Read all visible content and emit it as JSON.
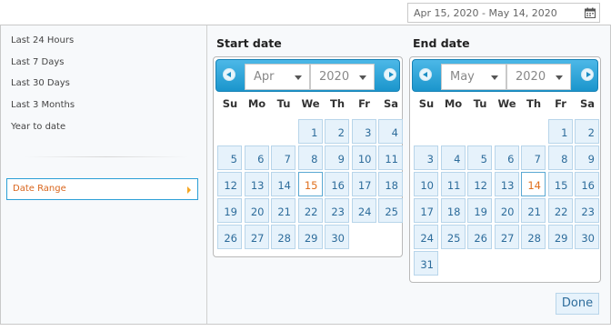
{
  "range_input": {
    "value": "Apr 15, 2020 - May 14, 2020",
    "icon": "calendar-icon"
  },
  "presets": [
    {
      "label": "Last 24 Hours"
    },
    {
      "label": "Last 7 Days"
    },
    {
      "label": "Last 30 Days"
    },
    {
      "label": "Last 3 Months"
    },
    {
      "label": "Year to date"
    }
  ],
  "date_range_label": "Date Range",
  "weekdays": [
    "Su",
    "Mo",
    "Tu",
    "We",
    "Th",
    "Fr",
    "Sa"
  ],
  "start": {
    "title": "Start date",
    "month": "Apr",
    "year": "2020",
    "first_weekday": 3,
    "days_in_month": 30,
    "highlight_day": 15
  },
  "end": {
    "title": "End date",
    "month": "May",
    "year": "2020",
    "first_weekday": 5,
    "days_in_month": 31,
    "highlight_day": 14
  },
  "done_label": "Done",
  "colors": {
    "accent": "#1b95cc",
    "highlight_text": "#e0701e",
    "day_bg": "#e6f2fb",
    "day_text": "#2d6c9b"
  }
}
